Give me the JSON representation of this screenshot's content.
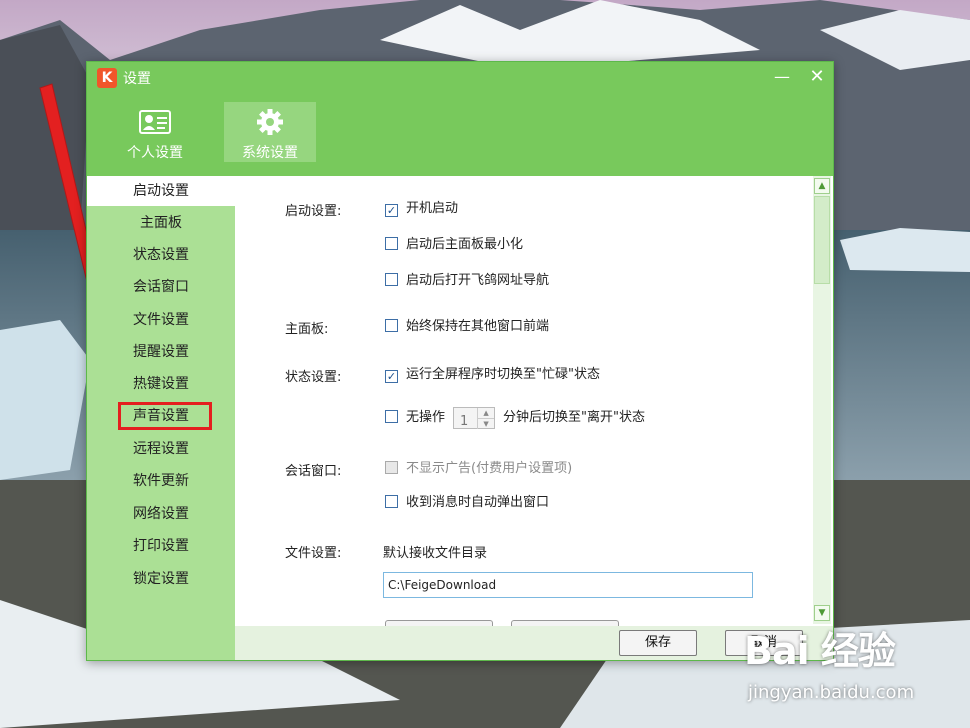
{
  "window": {
    "title": "设置",
    "logo_glyph": "K",
    "minimize_glyph": "—",
    "close_glyph": "✕"
  },
  "tabs": [
    {
      "label": "个人设置",
      "icon": "id-card-icon",
      "selected": false
    },
    {
      "label": "系统设置",
      "icon": "gear-icon",
      "selected": true
    }
  ],
  "sidebar": {
    "items": [
      {
        "label": "启动设置",
        "active": true
      },
      {
        "label": "主面板"
      },
      {
        "label": "状态设置"
      },
      {
        "label": "会话窗口"
      },
      {
        "label": "文件设置"
      },
      {
        "label": "提醒设置"
      },
      {
        "label": "热键设置"
      },
      {
        "label": "声音设置",
        "highlighted": true
      },
      {
        "label": "远程设置"
      },
      {
        "label": "软件更新"
      },
      {
        "label": "网络设置"
      },
      {
        "label": "打印设置"
      },
      {
        "label": "锁定设置"
      }
    ]
  },
  "sections": {
    "startup": {
      "label": "启动设置:",
      "options": [
        {
          "label": "开机启动",
          "checked": true
        },
        {
          "label": "启动后主面板最小化",
          "checked": false
        },
        {
          "label": "启动后打开飞鸽网址导航",
          "checked": false
        }
      ]
    },
    "mainpanel": {
      "label": "主面板:",
      "options": [
        {
          "label": "始终保持在其他窗口前端",
          "checked": false
        }
      ]
    },
    "status": {
      "label": "状态设置:",
      "fullscreen": {
        "label": "运行全屏程序时切换至\"忙碌\"状态",
        "checked": true
      },
      "idle": {
        "prefix": "无操作",
        "value": "1",
        "suffix": "分钟后切换至\"离开\"状态",
        "checked": false
      }
    },
    "chat": {
      "label": "会话窗口:",
      "options": [
        {
          "label": "不显示广告(付费用户设置项)",
          "checked": false,
          "disabled": true
        },
        {
          "label": "收到消息时自动弹出窗口",
          "checked": false
        }
      ]
    },
    "file": {
      "label": "文件设置:",
      "dir_label": "默认接收文件目录",
      "path": "C:\\FeigeDownload"
    }
  },
  "footer": {
    "save_label": "保存",
    "cancel_label": "取消"
  },
  "watermark": {
    "logo": "Bai 经验",
    "url": "jingyan.baidu.com"
  },
  "check_glyph": "✓",
  "colors": {
    "title_green": "#78c95c",
    "sidebar_green": "#abe095",
    "highlight_red": "#e41f1f",
    "arrow_red": "#e32020"
  }
}
